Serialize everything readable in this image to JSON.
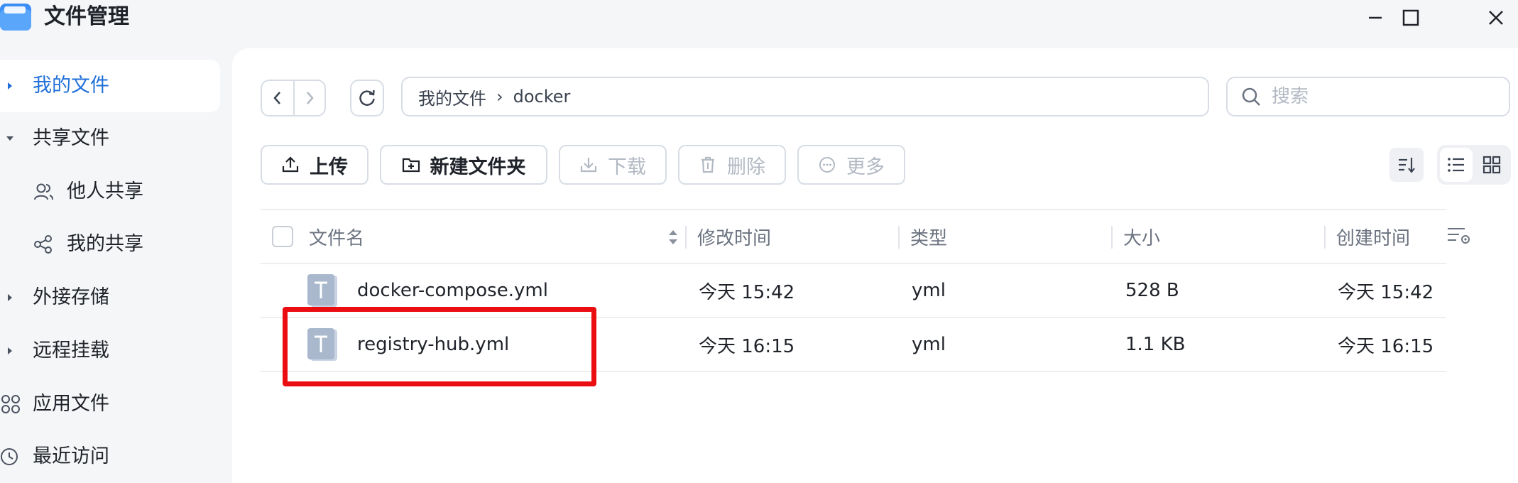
{
  "window": {
    "title": "文件管理",
    "app_icon": "folder-app-icon",
    "controls": [
      "minimize-icon",
      "maximize-icon",
      "close-icon"
    ]
  },
  "sidebar": {
    "items": [
      {
        "label": "我的文件",
        "icon": "caret-right-icon",
        "active": true
      },
      {
        "label": "共享文件",
        "icon": "caret-down-icon",
        "active": false
      },
      {
        "label": "他人共享",
        "icon": "users-icon",
        "active": false
      },
      {
        "label": "我的共享",
        "icon": "share-icon",
        "active": false
      },
      {
        "label": "外接存储",
        "icon": "caret-right-icon",
        "active": false
      },
      {
        "label": "远程挂载",
        "icon": "caret-right-icon",
        "active": false
      },
      {
        "label": "应用文件",
        "icon": "apps-icon",
        "active": false
      },
      {
        "label": "最近访问",
        "icon": "clock-icon",
        "active": false
      }
    ]
  },
  "pathbar": {
    "root": "我的文件",
    "separator": "›",
    "current": "docker"
  },
  "search": {
    "placeholder": "搜索"
  },
  "toolbar": {
    "upload": "上传",
    "new_folder": "新建文件夹",
    "download": "下载",
    "delete": "删除",
    "more": "更多"
  },
  "table": {
    "headers": {
      "name": "文件名",
      "modified": "修改时间",
      "type": "类型",
      "size": "大小",
      "created": "创建时间"
    },
    "rows": [
      {
        "name": "docker-compose.yml",
        "modified": "今天 15:42",
        "type": "yml",
        "size": "528 B",
        "created": "今天 15:42",
        "icon": "text-file-icon"
      },
      {
        "name": "registry-hub.yml",
        "modified": "今天 16:15",
        "type": "yml",
        "size": "1.1 KB",
        "created": "今天 16:15",
        "icon": "text-file-icon",
        "highlighted": true
      }
    ]
  },
  "colors": {
    "accent": "#1f6fd8",
    "highlight_box": "#ea0d12",
    "border": "#d8dde5",
    "muted_text": "#6b7380",
    "disabled_text": "#b3b9c3"
  }
}
